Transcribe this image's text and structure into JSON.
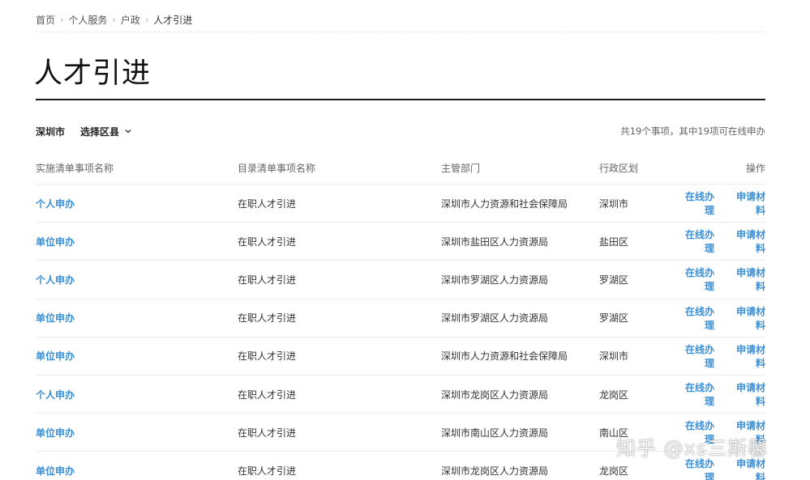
{
  "breadcrumb": {
    "items": [
      "首页",
      "个人服务",
      "户政",
      "人才引进"
    ]
  },
  "page": {
    "title": "人才引进"
  },
  "filter": {
    "city": "深圳市",
    "district_label": "选择区县",
    "summary": "共19个事项，其中19项可在线申办"
  },
  "table": {
    "headers": [
      "实施清单事项名称",
      "目录清单事项名称",
      "主管部门",
      "行政区划",
      "操作"
    ],
    "rows": [
      {
        "name": "个人申办",
        "catalog": "在职人才引进",
        "dept": "深圳市人力资源和社会保障局",
        "region": "深圳市",
        "action1": "在线办理",
        "action2": "申请材料"
      },
      {
        "name": "单位申办",
        "catalog": "在职人才引进",
        "dept": "深圳市盐田区人力资源局",
        "region": "盐田区",
        "action1": "在线办理",
        "action2": "申请材料"
      },
      {
        "name": "个人申办",
        "catalog": "在职人才引进",
        "dept": "深圳市罗湖区人力资源局",
        "region": "罗湖区",
        "action1": "在线办理",
        "action2": "申请材料"
      },
      {
        "name": "单位申办",
        "catalog": "在职人才引进",
        "dept": "深圳市罗湖区人力资源局",
        "region": "罗湖区",
        "action1": "在线办理",
        "action2": "申请材料"
      },
      {
        "name": "单位申办",
        "catalog": "在职人才引进",
        "dept": "深圳市人力资源和社会保障局",
        "region": "深圳市",
        "action1": "在线办理",
        "action2": "申请材料"
      },
      {
        "name": "个人申办",
        "catalog": "在职人才引进",
        "dept": "深圳市龙岗区人力资源局",
        "region": "龙岗区",
        "action1": "在线办理",
        "action2": "申请材料"
      },
      {
        "name": "单位申办",
        "catalog": "在职人才引进",
        "dept": "深圳市南山区人力资源局",
        "region": "南山区",
        "action1": "在线办理",
        "action2": "申请材料"
      },
      {
        "name": "单位申办",
        "catalog": "在职人才引进",
        "dept": "深圳市龙岗区人力资源局",
        "region": "龙岗区",
        "action1": "在线办理",
        "action2": "申请材料"
      }
    ]
  },
  "watermark": {
    "text": "知乎 @xs三斯馨"
  },
  "colors": {
    "link": "#3a8fd6",
    "rule": "#1d1d1d"
  },
  "icons": {
    "district_select": "chevron-down-icon"
  }
}
